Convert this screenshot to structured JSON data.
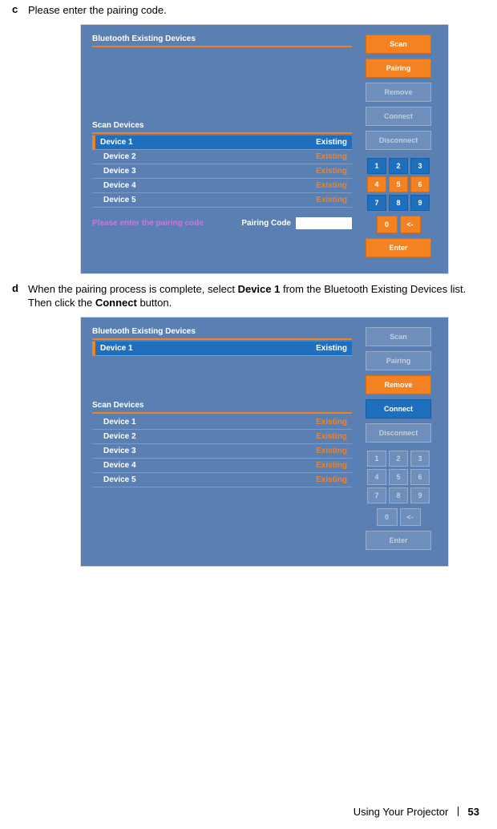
{
  "steps": {
    "c": {
      "letter": "c",
      "text": "Please enter the pairing code."
    },
    "d": {
      "letter": "d",
      "lead": "When the pairing process is complete, select ",
      "bold1": "Device 1",
      "mid": " from the Bluetooth Existing Devices list. Then click the ",
      "bold2": "Connect",
      "tail": " button."
    }
  },
  "panel1": {
    "existingTitle": "Bluetooth Existing Devices",
    "scanTitle": "Scan Devices",
    "devices": [
      {
        "name": "Device 1",
        "status": "Existing",
        "row_name": "device-row-1",
        "selected": true
      },
      {
        "name": "Device 2",
        "status": "Existing",
        "row_name": "device-row-2",
        "selected": false
      },
      {
        "name": "Device 3",
        "status": "Existing",
        "row_name": "device-row-3",
        "selected": false
      },
      {
        "name": "Device 4",
        "status": "Existing",
        "row_name": "device-row-4",
        "selected": false
      },
      {
        "name": "Device 5",
        "status": "Existing",
        "row_name": "device-row-5",
        "selected": false
      }
    ],
    "buttons": {
      "scan": "Scan",
      "pairing": "Pairing",
      "remove": "Remove",
      "connect": "Connect",
      "disconnect": "Disconnect",
      "enter": "Enter"
    },
    "keypad": [
      "1",
      "2",
      "3",
      "4",
      "5",
      "6",
      "7",
      "8",
      "9",
      "0",
      "<-"
    ],
    "prompt": "Please enter the pairing code",
    "pairingLabel": "Pairing Code"
  },
  "panel2": {
    "existingTitle": "Bluetooth Existing Devices",
    "existingDevices": [
      {
        "name": "Device 1",
        "status": "Existing",
        "row_name": "existing-device-row-1",
        "selected": true
      }
    ],
    "scanTitle": "Scan Devices",
    "devices": [
      {
        "name": "Device 1",
        "status": "Existing",
        "row_name": "scan-device-row-1"
      },
      {
        "name": "Device 2",
        "status": "Existing",
        "row_name": "scan-device-row-2"
      },
      {
        "name": "Device 3",
        "status": "Existing",
        "row_name": "scan-device-row-3"
      },
      {
        "name": "Device 4",
        "status": "Existing",
        "row_name": "scan-device-row-4"
      },
      {
        "name": "Device 5",
        "status": "Existing",
        "row_name": "scan-device-row-5"
      }
    ],
    "buttons": {
      "scan": "Scan",
      "pairing": "Pairing",
      "remove": "Remove",
      "connect": "Connect",
      "disconnect": "Disconnect",
      "enter": "Enter"
    },
    "keypad": [
      "1",
      "2",
      "3",
      "4",
      "5",
      "6",
      "7",
      "8",
      "9",
      "0",
      "<-"
    ]
  },
  "footer": {
    "section": "Using Your Projector",
    "page": "53"
  }
}
